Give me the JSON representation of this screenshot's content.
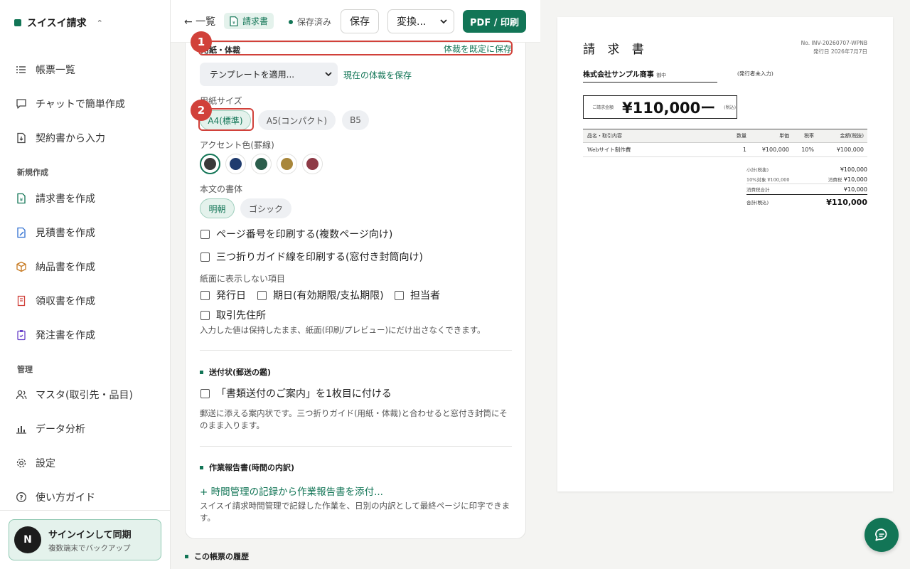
{
  "sidebar": {
    "brand": "スイスイ請求",
    "nav_top": [
      {
        "label": "帳票一覧",
        "icon": "list-icon"
      },
      {
        "label": "チャットで簡単作成",
        "icon": "chat-bubble-icon"
      },
      {
        "label": "契約書から入力",
        "icon": "document-import-icon"
      }
    ],
    "section_new": "新規作成",
    "nav_new": [
      {
        "label": "請求書を作成",
        "icon": "invoice-icon",
        "color": "#127556"
      },
      {
        "label": "見積書を作成",
        "icon": "estimate-icon",
        "color": "#2f6fd1"
      },
      {
        "label": "納品書を作成",
        "icon": "box-icon",
        "color": "#c77a21"
      },
      {
        "label": "領収書を作成",
        "icon": "receipt-icon",
        "color": "#d1413a"
      },
      {
        "label": "発注書を作成",
        "icon": "order-clipboard-icon",
        "color": "#6a43c9"
      }
    ],
    "section_manage": "管理",
    "nav_manage": [
      {
        "label": "マスタ(取引先・品目)",
        "icon": "users-icon"
      },
      {
        "label": "データ分析",
        "icon": "bar-chart-icon"
      },
      {
        "label": "設定",
        "icon": "gear-icon"
      },
      {
        "label": "使い方ガイド",
        "icon": "help-circle-icon"
      }
    ],
    "signin": {
      "avatar": "N",
      "title": "サインインして同期",
      "subtitle": "複数端末でバックアップ"
    }
  },
  "toolbar": {
    "back": "← 一覧",
    "doc_type": "請求書",
    "saved": "保存済み",
    "save": "保存",
    "convert": "変換...",
    "pdf": "PDF / 印刷"
  },
  "panel": {
    "section_paper": "用紙・体裁",
    "save_default": "体裁を既定に保存",
    "template_select": "テンプレートを適用...",
    "save_current": "現在の体裁を保存",
    "paper_size_label": "用紙サイズ",
    "paper_sizes": [
      "A4(標準)",
      "A5(コンパクト)",
      "B5"
    ],
    "paper_size_selected": "A4(標準)",
    "accent_label": "アクセント色(罫線)",
    "accent_colors": [
      "#3a3a3a",
      "#1f3b6e",
      "#2c5e4c",
      "#a8863a",
      "#8e3a46"
    ],
    "accent_selected": "#3a3a3a",
    "font_label": "本文の書体",
    "fonts": [
      "明朝",
      "ゴシック"
    ],
    "font_selected": "明朝",
    "print_page_numbers": "ページ番号を印刷する(複数ページ向け)",
    "print_fold_guides": "三つ折りガイド線を印刷する(窓付き封筒向け)",
    "hidden_items_label": "紙面に表示しない項目",
    "hidden_items": [
      "発行日",
      "期日(有効期限/支払期限)",
      "担当者",
      "取引先住所"
    ],
    "hidden_note": "入力した値は保持したまま、紙面(印刷/プレビュー)にだけ出さなくできます。",
    "section_cover": "送付状(郵送の鑑)",
    "cover_checkbox": "「書類送付のご案内」を1枚目に付ける",
    "cover_note": "郵送に添える案内状です。三つ折りガイド(用紙・体裁)と合わせると窓付き封筒にそのまま入ります。",
    "section_work": "作業報告書(時間の内訳)",
    "work_link": "+ 時間管理の記録から作業報告書を添付...",
    "work_note": "スイスイ請求時間管理で記録した作業を、日別の内訳として最終ページに印字できます。"
  },
  "annotations": [
    "1",
    "2"
  ],
  "history_title": "この帳票の履歴",
  "preview": {
    "title": "請 求 書",
    "number": "No. INV-20260707-WPNB",
    "issue_date": "発行日 2026年7月7日",
    "client": "株式会社サンプル商事",
    "honorific": "御中",
    "issuer_placeholder": "(発行者未入力)",
    "amount_label": "ご請求金額",
    "amount": "¥110,000ー",
    "tax_incl": "(税込)",
    "headers": [
      "品名・取引内容",
      "数量",
      "単価",
      "税率",
      "金額(税抜)"
    ],
    "rows": [
      [
        "Webサイト制作費",
        "1",
        "¥100,000",
        "10%",
        "¥100,000"
      ]
    ],
    "subtotal_label": "小計(税抜)",
    "subtotal": "¥100,000",
    "taxable_label": "10%対象 ¥100,000",
    "tax_sub_label": "消費税",
    "tax_amount": "¥10,000",
    "tax_total_label": "消費税合計",
    "tax_total": "¥10,000",
    "total_label": "合計(税込)",
    "total": "¥110,000"
  }
}
